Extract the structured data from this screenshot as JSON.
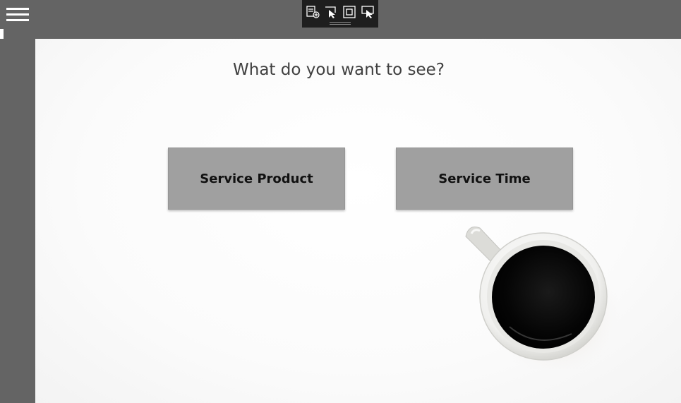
{
  "toolbar": {
    "icons": [
      "add-page-icon",
      "select-pointer-icon",
      "focus-mode-icon",
      "presentation-icon"
    ]
  },
  "main": {
    "question": "What do you want to see?",
    "buttons": {
      "service_product": "Service Product",
      "service_time": "Service Time"
    }
  },
  "colors": {
    "chrome": "#646464",
    "toolbar_bg": "#1e1e1e",
    "button_bg": "#a0a0a0",
    "canvas_bg": "#ffffff"
  }
}
